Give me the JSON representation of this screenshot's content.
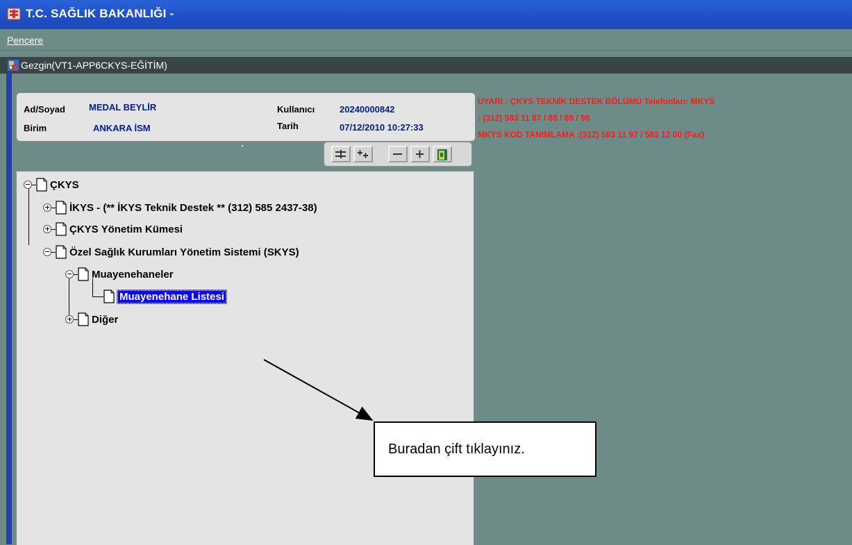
{
  "app": {
    "title": "T.C. SAĞLIK BAKANLIĞI -",
    "menu": "Pencere",
    "window_title": "Gezgin(VT1-APP6CKYS-EĞİTİM)"
  },
  "info": {
    "name_label": "Ad/Soyad",
    "name_value": "MEDAL BEYLİR",
    "user_label": "Kullanıcı",
    "user_value": "20240000842",
    "unit_label": "Birim",
    "unit_value": "ANKARA İSM",
    "date_label": "Tarih",
    "date_value": "07/12/2010 10:27:33"
  },
  "warning": {
    "line1": "UYARI :  ÇKYS TEKNİK DESTEK BÖLÜMÜ Telefonları:  MKYS",
    "line2": ": (312)  583 11 87 / 88 / 89 / 98",
    "line3": " MKYS KOD TANIMLAMA :(312) 583 11 97 / 583 12 00 (Fax)"
  },
  "tree": {
    "root": "ÇKYS",
    "ikys": "İKYS - (** İKYS Teknik Destek ** (312) 585 2437-38)",
    "ckys_yonetim": "ÇKYS Yönetim Kümesi",
    "skys": "Özel Sağlık Kurumları Yönetim Sistemi (SKYS)",
    "muayenehaneler": "Muayenehaneler",
    "muayenehane_listesi": "Muayenehane Listesi",
    "diger": "Diğer"
  },
  "callout": "Buradan çift tıklayınız.",
  "colors": {
    "titlebar": "#1f4fc4",
    "background": "#6d8c88",
    "warning": "#ff1a1a",
    "selection": "#0a0ae6"
  }
}
